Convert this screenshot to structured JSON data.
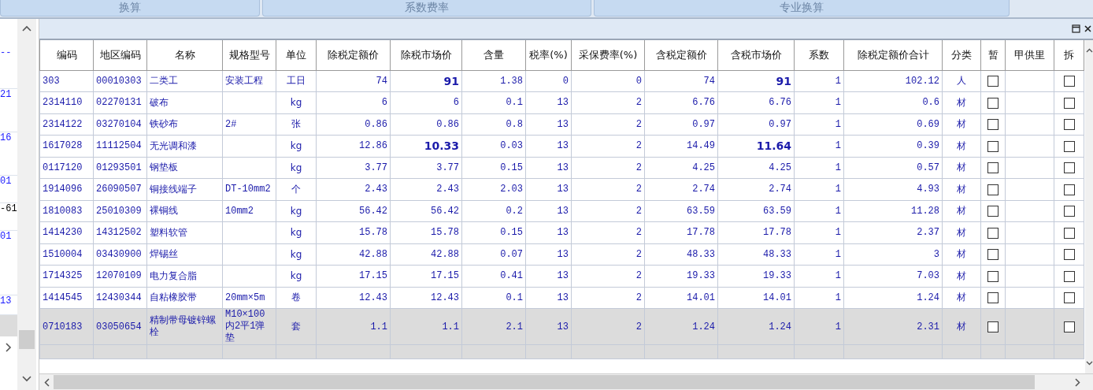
{
  "tabs": [
    {
      "label": "换算"
    },
    {
      "label": "系数费率"
    },
    {
      "label": "专业换算"
    }
  ],
  "left_panel": {
    "items": [
      {
        "text": "--",
        "kind": "code"
      },
      {
        "text": "21",
        "kind": "code"
      },
      {
        "text": "16",
        "kind": "code"
      },
      {
        "text": "01",
        "kind": "code"
      },
      {
        "text": "-61",
        "kind": "plain"
      },
      {
        "text": "01",
        "kind": "code"
      },
      {
        "text": "13",
        "kind": "code"
      }
    ]
  },
  "table": {
    "columns": [
      "编码",
      "地区编码",
      "名称",
      "规格型号",
      "单位",
      "除税定额价",
      "除税市场价",
      "含量",
      "税率(%)",
      "采保费率(%)",
      "含税定额价",
      "含税市场价",
      "系数",
      "除税定额价合计",
      "分类",
      "暂",
      "甲供里",
      "拆"
    ],
    "rows": [
      {
        "cells": [
          "303",
          "00010303",
          "二类工",
          "安装工程",
          "工日",
          "74",
          "91",
          "1.38",
          "0",
          "0",
          "74",
          "91",
          "1",
          "102.12",
          "人"
        ],
        "price_changed": true,
        "provisional": false,
        "split": false,
        "selected": false
      },
      {
        "cells": [
          "2314110",
          "02270131",
          "破布",
          "",
          "kg",
          "6",
          "6",
          "0.1",
          "13",
          "2",
          "6.76",
          "6.76",
          "1",
          "0.6",
          "材"
        ],
        "price_changed": false,
        "provisional": false,
        "split": false,
        "selected": false
      },
      {
        "cells": [
          "2314122",
          "03270104",
          "铁砂布",
          "2#",
          "张",
          "0.86",
          "0.86",
          "0.8",
          "13",
          "2",
          "0.97",
          "0.97",
          "1",
          "0.69",
          "材"
        ],
        "price_changed": false,
        "provisional": false,
        "split": false,
        "selected": false
      },
      {
        "cells": [
          "1617028",
          "11112504",
          "无光调和漆",
          "",
          "kg",
          "12.86",
          "10.33",
          "0.03",
          "13",
          "2",
          "14.49",
          "11.64",
          "1",
          "0.39",
          "材"
        ],
        "price_changed": true,
        "provisional": false,
        "split": false,
        "selected": false
      },
      {
        "cells": [
          "0117120",
          "01293501",
          "钢垫板",
          "",
          "kg",
          "3.77",
          "3.77",
          "0.15",
          "13",
          "2",
          "4.25",
          "4.25",
          "1",
          "0.57",
          "材"
        ],
        "price_changed": false,
        "provisional": false,
        "split": false,
        "selected": false
      },
      {
        "cells": [
          "1914096",
          "26090507",
          "铜接线端子",
          "DT-10mm2",
          "个",
          "2.43",
          "2.43",
          "2.03",
          "13",
          "2",
          "2.74",
          "2.74",
          "1",
          "4.93",
          "材"
        ],
        "price_changed": false,
        "provisional": false,
        "split": false,
        "selected": false
      },
      {
        "cells": [
          "1810083",
          "25010309",
          "裸铜线",
          "10mm2",
          "kg",
          "56.42",
          "56.42",
          "0.2",
          "13",
          "2",
          "63.59",
          "63.59",
          "1",
          "11.28",
          "材"
        ],
        "price_changed": false,
        "provisional": false,
        "split": false,
        "selected": false
      },
      {
        "cells": [
          "1414230",
          "14312502",
          "塑料软管",
          "",
          "kg",
          "15.78",
          "15.78",
          "0.15",
          "13",
          "2",
          "17.78",
          "17.78",
          "1",
          "2.37",
          "材"
        ],
        "price_changed": false,
        "provisional": false,
        "split": false,
        "selected": false
      },
      {
        "cells": [
          "1510004",
          "03430900",
          "焊锡丝",
          "",
          "kg",
          "42.88",
          "42.88",
          "0.07",
          "13",
          "2",
          "48.33",
          "48.33",
          "1",
          "3",
          "材"
        ],
        "price_changed": false,
        "provisional": false,
        "split": false,
        "selected": false
      },
      {
        "cells": [
          "1714325",
          "12070109",
          "电力复合脂",
          "",
          "kg",
          "17.15",
          "17.15",
          "0.41",
          "13",
          "2",
          "19.33",
          "19.33",
          "1",
          "7.03",
          "材"
        ],
        "price_changed": false,
        "provisional": false,
        "split": false,
        "selected": false
      },
      {
        "cells": [
          "1414545",
          "12430344",
          "自粘橡胶带",
          "20mm×5m",
          "卷",
          "12.43",
          "12.43",
          "0.1",
          "13",
          "2",
          "14.01",
          "14.01",
          "1",
          "1.24",
          "材"
        ],
        "price_changed": false,
        "provisional": false,
        "split": false,
        "selected": false
      },
      {
        "cells": [
          "0710183",
          "03050654",
          "精制带母镀锌螺栓",
          "M10×100内2平1弹垫",
          "套",
          "1.1",
          "1.1",
          "2.1",
          "13",
          "2",
          "1.24",
          "1.24",
          "1",
          "2.31",
          "材"
        ],
        "price_changed": false,
        "provisional": false,
        "split": false,
        "selected": true
      }
    ]
  }
}
